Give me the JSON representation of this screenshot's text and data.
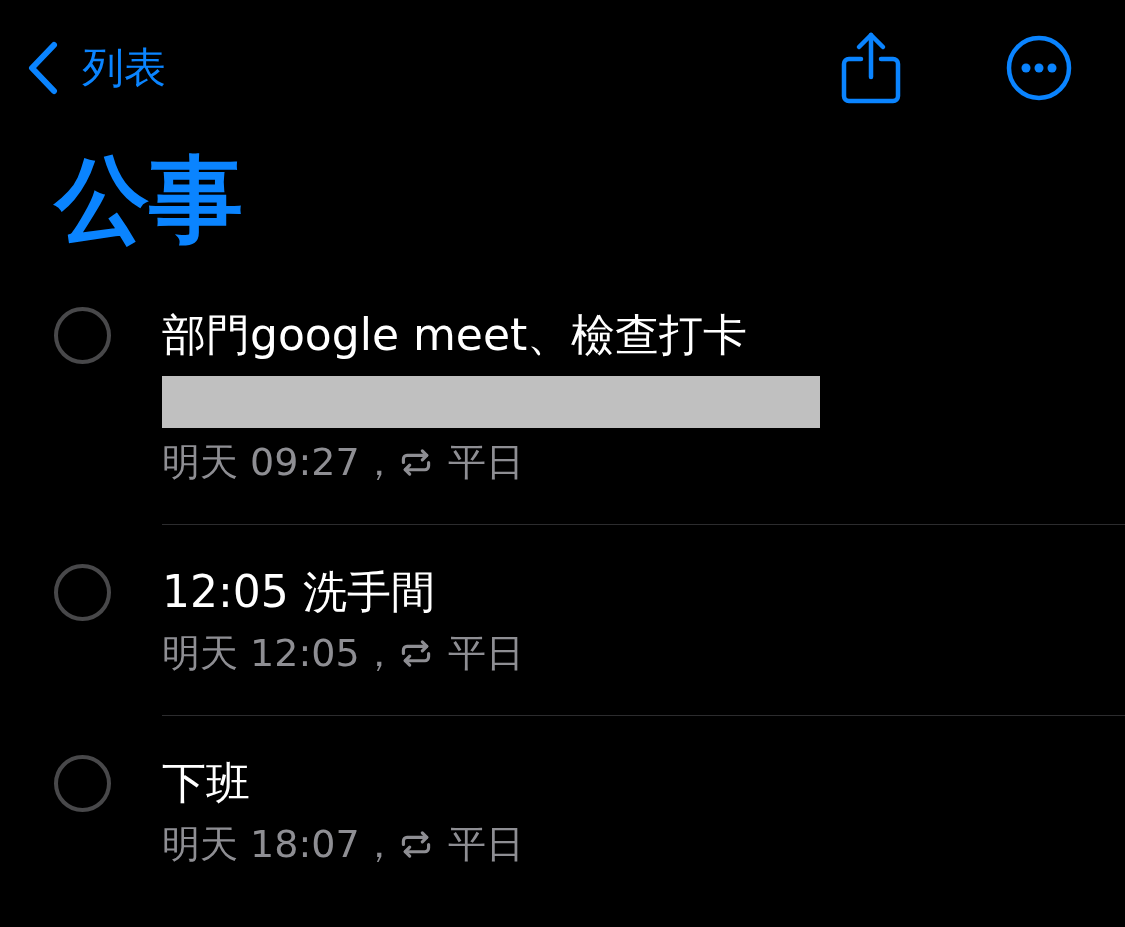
{
  "nav": {
    "back_label": "列表"
  },
  "title": "公事",
  "reminders": [
    {
      "title": "部門google meet、檢查打卡",
      "completed": false,
      "redacted": true,
      "due": "明天 09:27，",
      "repeat": "平日"
    },
    {
      "title": "12:05 洗手間",
      "completed": false,
      "redacted": false,
      "due": "明天 12:05，",
      "repeat": "平日"
    },
    {
      "title": "下班",
      "completed": false,
      "redacted": false,
      "due": "明天 18:07，",
      "repeat": "平日"
    }
  ]
}
